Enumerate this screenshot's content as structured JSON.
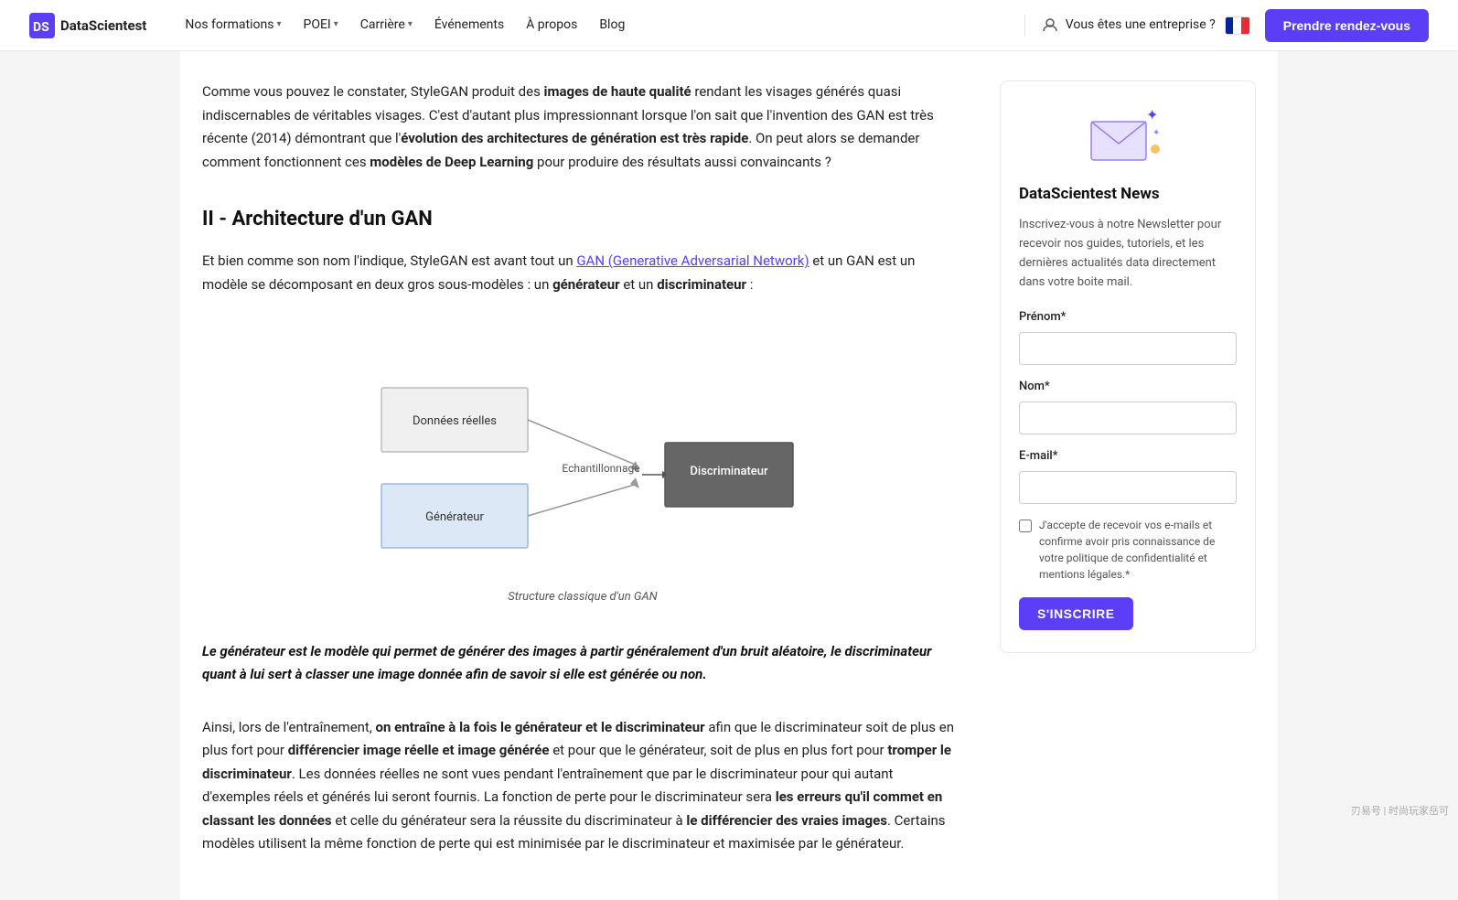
{
  "navbar": {
    "logo_text": "DataScientest",
    "nav_items": [
      {
        "label": "Nos formations",
        "has_dropdown": true
      },
      {
        "label": "POEI",
        "has_dropdown": true
      },
      {
        "label": "Carrière",
        "has_dropdown": true
      },
      {
        "label": "Événements",
        "has_dropdown": false
      },
      {
        "label": "À propos",
        "has_dropdown": false
      },
      {
        "label": "Blog",
        "has_dropdown": false
      }
    ],
    "enterprise_label": "Vous êtes une entreprise ?",
    "cta_label": "Prendre rendez-vous"
  },
  "main": {
    "intro_paragraph": "Comme vous pouvez le constater, StyleGAN produit des images de haute qualité rendant les visages générés quasi indiscernables de véritables visages. C'est d'autant plus impressionnant lorsque l'on sait que l'invention des GAN est très récente (2014) démontrant que l'évolution des architectures de génération est très rapide. On peut alors se demander comment fonctionnent ces modèles de Deep Learning pour produire des résultats aussi convaincants ?",
    "section_title": "II - Architecture d'un GAN",
    "section_intro_part1": "Et bien comme son nom l'indique, StyleGAN est avant tout un ",
    "gan_link_text": "GAN (Generative Adversarial Network)",
    "section_intro_part2": " et un GAN est un modèle se décomposant en deux gros sous-modèles : un générateur et un discriminateur :",
    "diagram_caption": "Structure classique d'un GAN",
    "diagram": {
      "donnees_label": "Données réelles",
      "generateur_label": "Générateur",
      "echantillonnage_label": "Echantillonnage",
      "discriminateur_label": "Discriminateur"
    },
    "quote_text": "Le générateur est le modèle qui permet de générer des images à partir généralement d'un bruit aléatoire, le discriminateur quant à lui sert à classer une image donnée afin de savoir si elle est générée ou non.",
    "body_text_1": "Ainsi, lors de l'entraînement, on entraîne à la fois le générateur et le discriminateur afin que le discriminateur soit de plus en plus fort pour différencier image réelle et image générée et pour que le générateur, soit de plus en plus fort pour tromper le discriminateur. Les données réelles ne sont vues pendant l'entraînement que par le discriminateur pour qui autant d'exemples réels et générés lui seront fournis. La fonction de perte pour le discriminateur sera les erreurs qu'il commet en classant les données et celle du générateur sera la réussite du discriminateur à le différencier des vraies images. Certains modèles utilisent la même fonction de perte qui est minimisée par le discriminateur et maximisée par le générateur."
  },
  "sidebar": {
    "newsletter_title": "DataScientest News",
    "newsletter_desc": "Inscrivez-vous à notre Newsletter pour recevoir nos guides, tutoriels, et les dernières actualités data directement dans votre boite mail.",
    "prenom_label": "Prénom*",
    "nom_label": "Nom*",
    "email_label": "E-mail*",
    "checkbox_text": "J'accepte de recevoir vos e-mails et confirme avoir pris connaissance de votre politique de confidentialité et mentions légales.*",
    "subscribe_label": "S'INSCRIRE"
  }
}
